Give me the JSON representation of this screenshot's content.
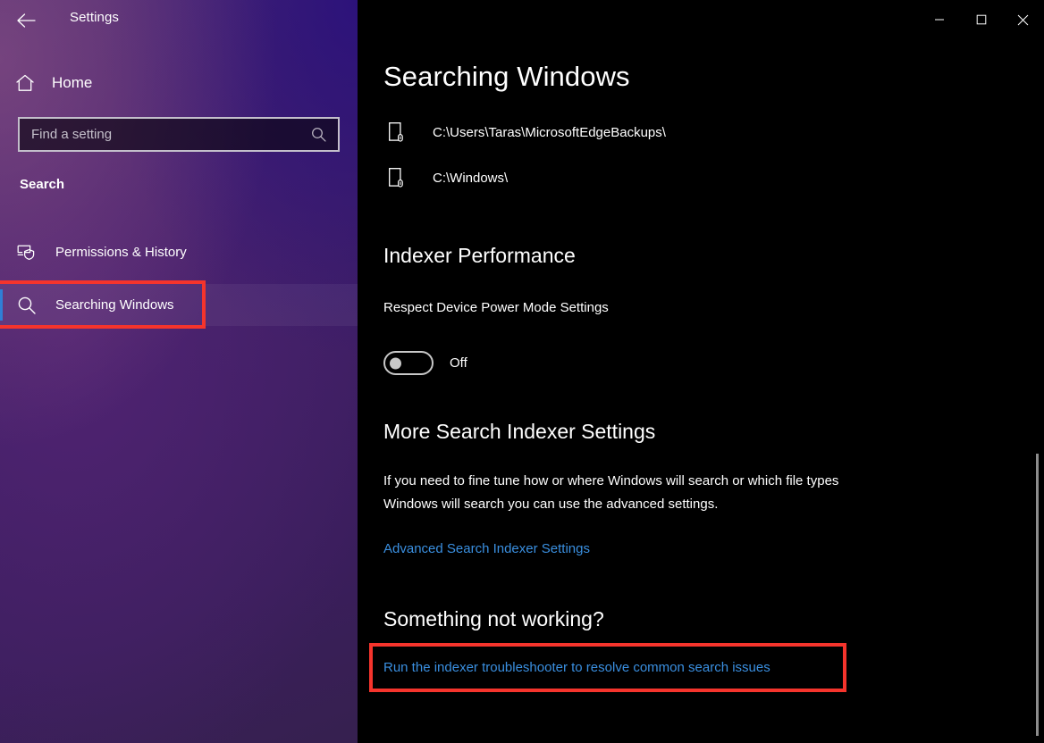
{
  "window": {
    "app_title": "Settings",
    "back_icon": "back-arrow-icon",
    "controls": {
      "minimize_label": "Minimize",
      "maximize_label": "Maximize",
      "close_label": "Close"
    }
  },
  "sidebar": {
    "home": {
      "label": "Home",
      "icon": "home-icon"
    },
    "search": {
      "placeholder": "Find a setting",
      "value": "",
      "icon": "search-icon"
    },
    "section_label": "Search",
    "items": [
      {
        "label": "Permissions & History",
        "icon": "permissions-shield-icon",
        "selected": false
      },
      {
        "label": "Searching Windows",
        "icon": "search-magnifier-icon",
        "selected": true
      }
    ]
  },
  "main": {
    "page_title": "Searching Windows",
    "excluded_paths": [
      {
        "path": "C:\\Users\\Taras\\MicrosoftEdgeBackups\\",
        "icon": "folder-page-icon"
      },
      {
        "path": "C:\\Windows\\",
        "icon": "folder-page-icon"
      }
    ],
    "indexer_performance": {
      "heading": "Indexer Performance",
      "setting_label": "Respect Device Power Mode Settings",
      "toggle_state": "Off"
    },
    "more_settings": {
      "heading": "More Search Indexer Settings",
      "description": "If you need to fine tune how or where Windows will search or which file types Windows will search you can use the advanced settings.",
      "link": "Advanced Search Indexer Settings"
    },
    "troubleshoot": {
      "heading": "Something not working?",
      "link": "Run the indexer troubleshooter to resolve common search issues"
    }
  },
  "colors": {
    "link": "#3a8fe0",
    "annotation": "#f5342c",
    "accent_selected": "#2f7fd6",
    "main_background": "#000000"
  }
}
